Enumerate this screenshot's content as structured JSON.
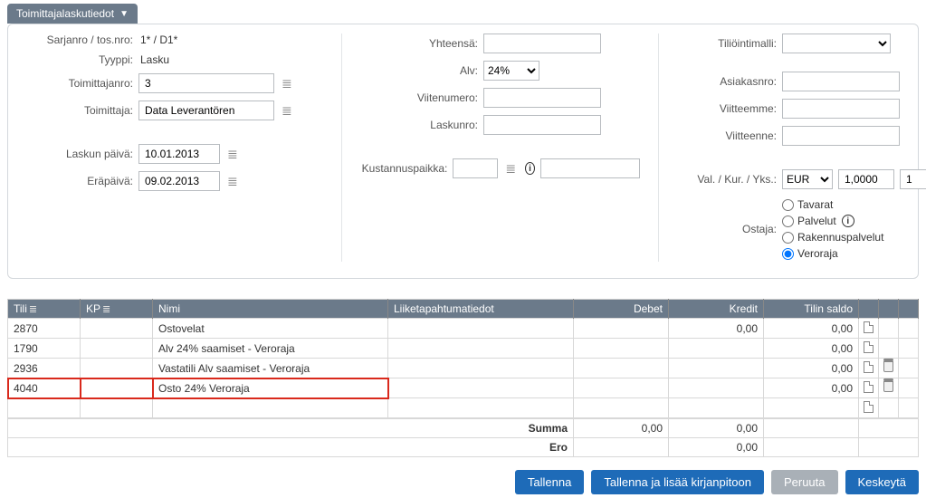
{
  "tab": {
    "title": "Toimittajalaskutiedot"
  },
  "form": {
    "serial_label": "Sarjanro / tos.nro:",
    "serial_value": "1* / D1*",
    "type_label": "Tyyppi:",
    "type_value": "Lasku",
    "supplier_no_label": "Toimittajanro:",
    "supplier_no_value": "3",
    "supplier_label": "Toimittaja:",
    "supplier_value": "Data Leverantören",
    "invoice_date_label": "Laskun päivä:",
    "invoice_date_value": "10.01.2013",
    "due_date_label": "Eräpäivä:",
    "due_date_value": "09.02.2013",
    "total_label": "Yhteensä:",
    "vat_label": "Alv:",
    "vat_value": "24%",
    "ref_label": "Viitenumero:",
    "invno_label": "Laskunro:",
    "cost_center_label": "Kustannuspaikka:",
    "accmodel_label": "Tiliöintimalli:",
    "custno_label": "Asiakasnro:",
    "ourref_label": "Viitteemme:",
    "yourref_label": "Viitteenne:",
    "currency_label": "Val. / Kur. / Yks.:",
    "currency_value": "EUR",
    "rate_value": "1,0000",
    "unit_value": "1",
    "buyer_label": "Ostaja:",
    "opt_goods": "Tavarat",
    "opt_services": "Palvelut",
    "opt_construction": "Rakennuspalvelut",
    "opt_veroraja": "Veroraja"
  },
  "grid": {
    "headers": {
      "account": "Tili",
      "kp": "KP",
      "name": "Nimi",
      "ledger": "Liiketapahtumatiedot",
      "debit": "Debet",
      "credit": "Kredit",
      "balance": "Tilin saldo"
    },
    "rows": [
      {
        "account": "2870",
        "kp": "",
        "name": "Ostovelat",
        "ledger": "",
        "debit": "",
        "credit": "0,00",
        "balance": "0,00",
        "trash": false
      },
      {
        "account": "1790",
        "kp": "",
        "name": "Alv 24% saamiset  - Veroraja",
        "ledger": "",
        "debit": "",
        "credit": "",
        "balance": "0,00",
        "trash": false
      },
      {
        "account": "2936",
        "kp": "",
        "name": "Vastatili Alv saamiset - Veroraja",
        "ledger": "",
        "debit": "",
        "credit": "",
        "balance": "0,00",
        "trash": true
      },
      {
        "account": "4040",
        "kp": "",
        "name": "Osto 24% Veroraja",
        "ledger": "",
        "debit": "",
        "credit": "",
        "balance": "0,00",
        "trash": true
      }
    ],
    "sum_label": "Summa",
    "sum_debit": "0,00",
    "sum_credit": "0,00",
    "diff_label": "Ero",
    "diff_value": "0,00"
  },
  "buttons": {
    "save": "Tallenna",
    "save_add": "Tallenna ja lisää kirjanpitoon",
    "cancel": "Peruuta",
    "abort": "Keskeytä"
  }
}
